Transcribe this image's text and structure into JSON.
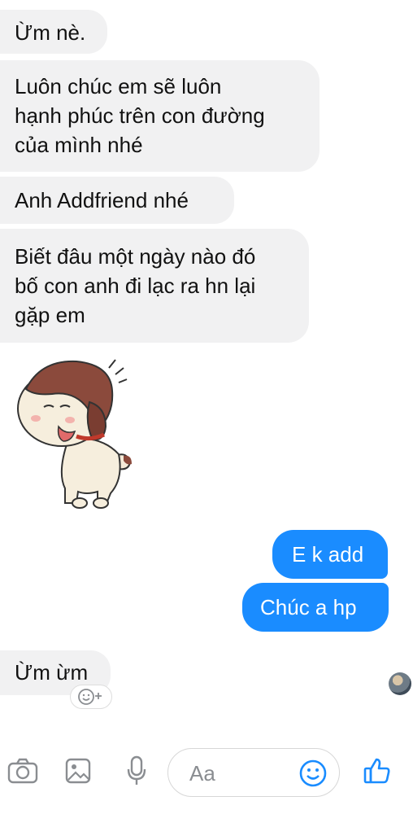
{
  "messages": {
    "incoming_1": "Ừm nè.",
    "incoming_2_lines": [
      "Luôn chúc em sẽ luôn",
      "hạnh phúc trên con đường",
      "của mình nhé"
    ],
    "incoming_3": "Anh Addfriend nhé",
    "incoming_4_lines": [
      "Biết đâu một ngày nào đó",
      "bố con anh đi lạc ra hn lại",
      "gặp em"
    ],
    "outgoing_1": "E k add",
    "outgoing_2": "Chúc a hp",
    "incoming_5": "Ừm ừm"
  },
  "composer": {
    "placeholder": "Aa"
  },
  "colors": {
    "incoming_bubble": "#f1f1f2",
    "outgoing_bubble": "#1a8cff",
    "accent_icon": "#1a8cff",
    "toolbar_icon": "#8a8d91"
  },
  "icons": [
    "camera-icon",
    "gallery-icon",
    "microphone-icon",
    "emoji-icon",
    "like-thumb-icon",
    "add-reaction-icon"
  ]
}
